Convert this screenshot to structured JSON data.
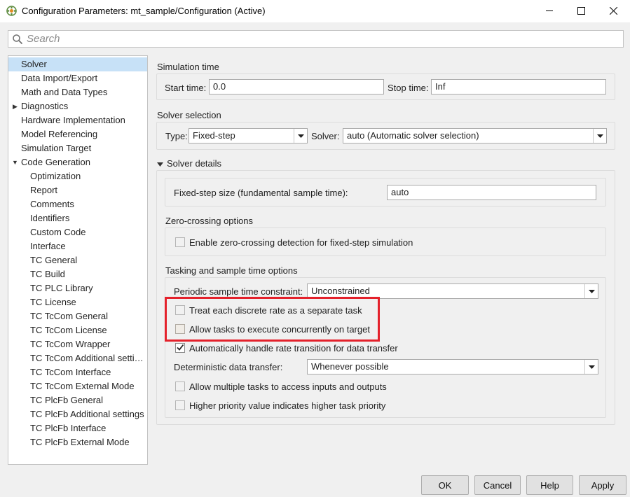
{
  "window": {
    "title": "Configuration Parameters: mt_sample/Configuration (Active)",
    "minimize_icon": "minimize-icon",
    "maximize_icon": "maximize-icon",
    "close_icon": "close-icon"
  },
  "search": {
    "placeholder": "Search",
    "value": ""
  },
  "tree": {
    "items": [
      {
        "label": "Solver",
        "selected": true
      },
      {
        "label": "Data Import/Export"
      },
      {
        "label": "Math and Data Types"
      },
      {
        "label": "Diagnostics",
        "expander": "collapsed"
      },
      {
        "label": "Hardware Implementation"
      },
      {
        "label": "Model Referencing"
      },
      {
        "label": "Simulation Target"
      },
      {
        "label": "Code Generation",
        "expander": "expanded"
      },
      {
        "label": "Optimization"
      },
      {
        "label": "Report"
      },
      {
        "label": "Comments"
      },
      {
        "label": "Identifiers"
      },
      {
        "label": "Custom Code"
      },
      {
        "label": "Interface"
      },
      {
        "label": "TC General"
      },
      {
        "label": "TC Build"
      },
      {
        "label": "TC PLC Library"
      },
      {
        "label": "TC License"
      },
      {
        "label": "TC TcCom General"
      },
      {
        "label": "TC TcCom License"
      },
      {
        "label": "TC TcCom Wrapper"
      },
      {
        "label": "TC TcCom Additional setti…"
      },
      {
        "label": "TC TcCom Interface"
      },
      {
        "label": "TC TcCom External Mode"
      },
      {
        "label": "TC PlcFb General"
      },
      {
        "label": "TC PlcFb Additional settings"
      },
      {
        "label": "TC PlcFb Interface"
      },
      {
        "label": "TC PlcFb External Mode"
      }
    ]
  },
  "simulation_time": {
    "title": "Simulation time",
    "start_label": "Start time:",
    "start_value": "0.0",
    "stop_label": "Stop time:",
    "stop_value": "Inf"
  },
  "solver_selection": {
    "title": "Solver selection",
    "type_label": "Type:",
    "type_value": "Fixed-step",
    "solver_label": "Solver:",
    "solver_value": "auto (Automatic solver selection)"
  },
  "solver_details": {
    "title": "Solver details",
    "fixed_step_label": "Fixed-step size (fundamental sample time):",
    "fixed_step_value": "auto",
    "zero_crossing": {
      "title": "Zero-crossing options",
      "enable_label": "Enable zero-crossing detection for fixed-step simulation",
      "enable_checked": false
    },
    "tasking": {
      "title": "Tasking and sample time options",
      "periodic_label": "Periodic sample time constraint:",
      "periodic_value": "Unconstrained",
      "treat_label": "Treat each discrete rate as a separate task",
      "treat_checked": false,
      "allow_concurrent_label": "Allow tasks to execute concurrently on target",
      "allow_concurrent_checked": false,
      "auto_rate_label": "Automatically handle rate transition for data transfer",
      "auto_rate_checked": true,
      "deterministic_label": "Deterministic data transfer:",
      "deterministic_value": "Whenever possible",
      "multi_access_label": "Allow multiple tasks to access inputs and outputs",
      "multi_access_checked": false,
      "priority_label": "Higher priority value indicates higher task priority",
      "priority_checked": false
    }
  },
  "buttons": {
    "ok": "OK",
    "cancel": "Cancel",
    "help": "Help",
    "apply": "Apply"
  },
  "colors": {
    "highlight": "#e4212b",
    "selection": "#c7e1f7",
    "background": "#f0f0f0"
  }
}
